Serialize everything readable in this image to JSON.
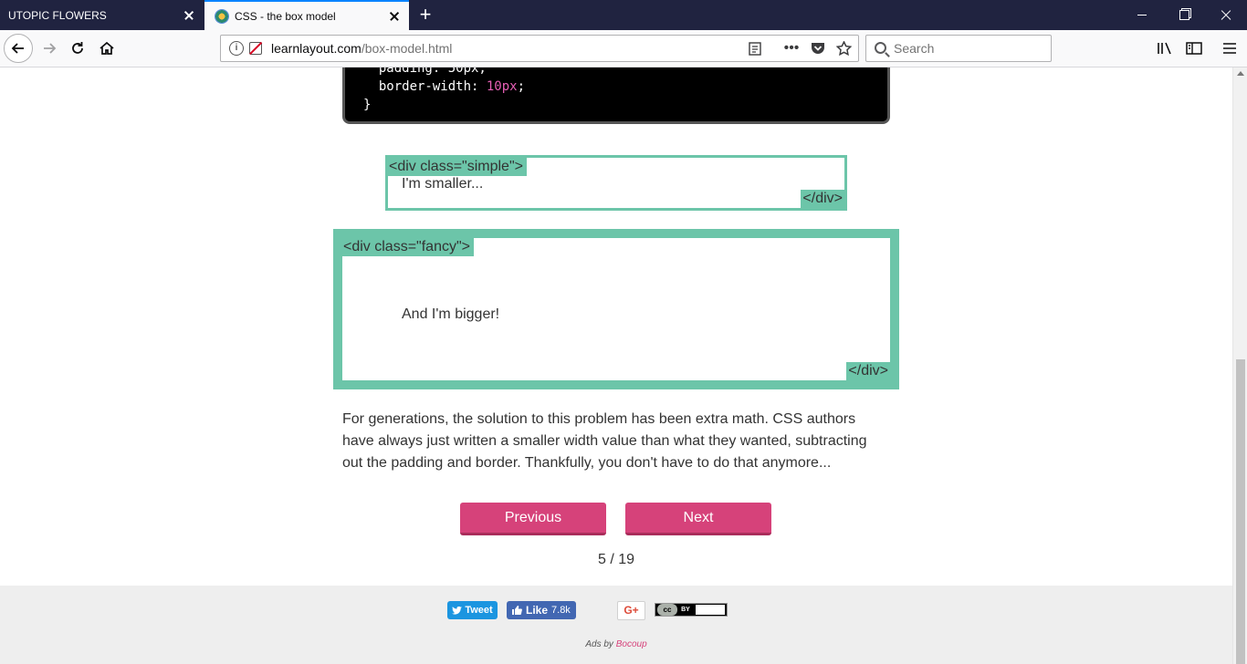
{
  "tabs": [
    {
      "title": "UTOPIC FLOWERS",
      "active": false
    },
    {
      "title": "CSS - the box model",
      "active": true
    }
  ],
  "new_tab_icon": "plus-icon",
  "navbar": {
    "url_host": "learnlayout.com",
    "url_path": "/box-model.html",
    "search_placeholder": "Search",
    "icons": [
      "back-arrow-icon",
      "forward-arrow-icon",
      "reload-icon",
      "home-icon",
      "info-icon",
      "insecure-lock-icon",
      "reader-view-icon",
      "more-actions-icon",
      "pocket-icon",
      "bookmark-star-icon",
      "library-icon",
      "sidebar-icon",
      "menu-icon"
    ]
  },
  "code": {
    "line_partial": "padding: 50px;",
    "line_prop": "border-width:",
    "line_value": "10px",
    "line_end": ";",
    "closing": "}"
  },
  "simple_box": {
    "open_tag": "<div class=\"simple\">",
    "text": "I'm smaller...",
    "close_tag": "</div>"
  },
  "fancy_box": {
    "open_tag": "<div class=\"fancy\">",
    "text": "And I'm bigger!",
    "close_tag": "</div>"
  },
  "paragraph": "For generations, the solution to this problem has been extra math. CSS authors have always just written a smaller width value than what they wanted, subtracting out the padding and border. Thankfully, you don't have to do that anymore...",
  "pagination": {
    "previous_label": "Previous",
    "next_label": "Next",
    "counter": "5 / 19"
  },
  "footer": {
    "tweet_label": "Tweet",
    "like_label": "Like",
    "like_count": "7.8k",
    "gplus_label": "G+",
    "cc_label": "cc",
    "by_label": "BY",
    "ads_prefix": "Ads by",
    "ads_brand": "Bocoup"
  },
  "colors": {
    "accent_green": "#6cc5a9",
    "button_pink": "#d6427a",
    "tabbar": "#202340"
  }
}
